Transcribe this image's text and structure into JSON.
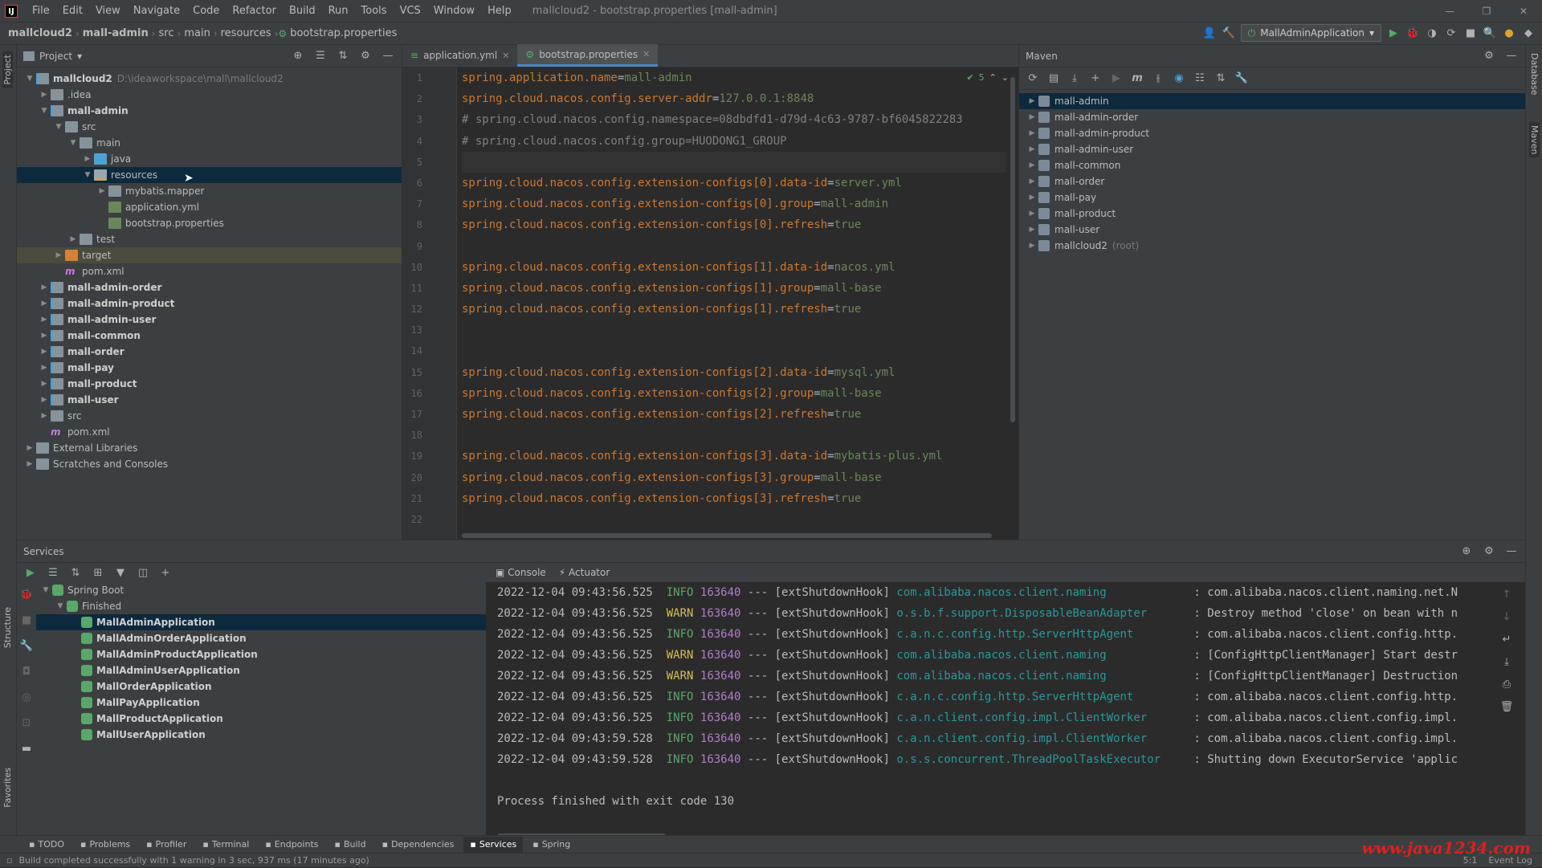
{
  "menubar": {
    "items": [
      "File",
      "Edit",
      "View",
      "Navigate",
      "Code",
      "Refactor",
      "Build",
      "Run",
      "Tools",
      "VCS",
      "Window",
      "Help"
    ],
    "title": "mallcloud2 - bootstrap.properties [mall-admin]"
  },
  "breadcrumb": [
    "mallcloud2",
    "mall-admin",
    "src",
    "main",
    "resources",
    "bootstrap.properties"
  ],
  "run_config": "MallAdminApplication",
  "project": {
    "title": "Project",
    "tree": [
      {
        "depth": 0,
        "arrow": "▼",
        "icon": "foldmod",
        "label": "mallcloud2",
        "path": "D:\\ideaworkspace\\mall\\mallcloud2",
        "bold": true
      },
      {
        "depth": 1,
        "arrow": "▶",
        "icon": "fold",
        "label": ".idea"
      },
      {
        "depth": 1,
        "arrow": "▼",
        "icon": "foldmod",
        "label": "mall-admin",
        "bold": true
      },
      {
        "depth": 2,
        "arrow": "▼",
        "icon": "fold",
        "label": "src"
      },
      {
        "depth": 3,
        "arrow": "▼",
        "icon": "fold",
        "label": "main"
      },
      {
        "depth": 4,
        "arrow": "▶",
        "icon": "foldsrc",
        "label": "java"
      },
      {
        "depth": 4,
        "arrow": "▼",
        "icon": "foldres",
        "label": "resources",
        "selected": true
      },
      {
        "depth": 5,
        "arrow": "▶",
        "icon": "fold",
        "label": "mybatis.mapper"
      },
      {
        "depth": 5,
        "arrow": "",
        "icon": "fileyml",
        "label": "application.yml"
      },
      {
        "depth": 5,
        "arrow": "",
        "icon": "fileyml",
        "label": "bootstrap.properties"
      },
      {
        "depth": 3,
        "arrow": "▶",
        "icon": "fold",
        "label": "test"
      },
      {
        "depth": 2,
        "arrow": "▶",
        "icon": "foldorange",
        "label": "target",
        "excluded": true
      },
      {
        "depth": 2,
        "arrow": "",
        "icon": "m",
        "label": "pom.xml"
      },
      {
        "depth": 1,
        "arrow": "▶",
        "icon": "foldmod",
        "label": "mall-admin-order",
        "bold": true
      },
      {
        "depth": 1,
        "arrow": "▶",
        "icon": "foldmod",
        "label": "mall-admin-product",
        "bold": true
      },
      {
        "depth": 1,
        "arrow": "▶",
        "icon": "foldmod",
        "label": "mall-admin-user",
        "bold": true
      },
      {
        "depth": 1,
        "arrow": "▶",
        "icon": "foldmod",
        "label": "mall-common",
        "bold": true
      },
      {
        "depth": 1,
        "arrow": "▶",
        "icon": "foldmod",
        "label": "mall-order",
        "bold": true
      },
      {
        "depth": 1,
        "arrow": "▶",
        "icon": "foldmod",
        "label": "mall-pay",
        "bold": true
      },
      {
        "depth": 1,
        "arrow": "▶",
        "icon": "foldmod",
        "label": "mall-product",
        "bold": true
      },
      {
        "depth": 1,
        "arrow": "▶",
        "icon": "foldmod",
        "label": "mall-user",
        "bold": true
      },
      {
        "depth": 1,
        "arrow": "▶",
        "icon": "fold",
        "label": "src"
      },
      {
        "depth": 1,
        "arrow": "",
        "icon": "m",
        "label": "pom.xml"
      },
      {
        "depth": 0,
        "arrow": "▶",
        "icon": "fold",
        "label": "External Libraries"
      },
      {
        "depth": 0,
        "arrow": "▶",
        "icon": "fold",
        "label": "Scratches and Consoles"
      }
    ]
  },
  "editor": {
    "tabs": [
      {
        "label": "application.yml",
        "active": false
      },
      {
        "label": "bootstrap.properties",
        "active": true
      }
    ],
    "inspection_count": "5",
    "lines": [
      {
        "type": "kv",
        "key": "spring.application.name",
        "val": "mall-admin"
      },
      {
        "type": "kv",
        "key": "spring.cloud.nacos.config.server-addr",
        "val": "127.0.0.1:8848"
      },
      {
        "type": "cmt",
        "text": "# spring.cloud.nacos.config.namespace=08dbdfd1-d79d-4c63-9787-bf6045822283"
      },
      {
        "type": "cmt",
        "text": "# spring.cloud.nacos.config.group=HUODONG1_GROUP"
      },
      {
        "type": "blank",
        "cur": true
      },
      {
        "type": "kv",
        "key": "spring.cloud.nacos.config.extension-configs[0].data-id",
        "val": "server.yml"
      },
      {
        "type": "kv",
        "key": "spring.cloud.nacos.config.extension-configs[0].group",
        "val": "mall-admin"
      },
      {
        "type": "kv",
        "key": "spring.cloud.nacos.config.extension-configs[0].refresh",
        "val": "true"
      },
      {
        "type": "blank"
      },
      {
        "type": "kv",
        "key": "spring.cloud.nacos.config.extension-configs[1].data-id",
        "val": "nacos.yml"
      },
      {
        "type": "kv",
        "key": "spring.cloud.nacos.config.extension-configs[1].group",
        "val": "mall-base"
      },
      {
        "type": "kv",
        "key": "spring.cloud.nacos.config.extension-configs[1].refresh",
        "val": "true"
      },
      {
        "type": "blank"
      },
      {
        "type": "blank"
      },
      {
        "type": "kv",
        "key": "spring.cloud.nacos.config.extension-configs[2].data-id",
        "val": "mysql.yml"
      },
      {
        "type": "kv",
        "key": "spring.cloud.nacos.config.extension-configs[2].group",
        "val": "mall-base"
      },
      {
        "type": "kv",
        "key": "spring.cloud.nacos.config.extension-configs[2].refresh",
        "val": "true"
      },
      {
        "type": "blank"
      },
      {
        "type": "kv",
        "key": "spring.cloud.nacos.config.extension-configs[3].data-id",
        "val": "mybatis-plus.yml"
      },
      {
        "type": "kv",
        "key": "spring.cloud.nacos.config.extension-configs[3].group",
        "val": "mall-base"
      },
      {
        "type": "kv",
        "key": "spring.cloud.nacos.config.extension-configs[3].refresh",
        "val": "true"
      },
      {
        "type": "blank"
      }
    ]
  },
  "maven": {
    "title": "Maven",
    "items": [
      {
        "label": "mall-admin",
        "selected": true
      },
      {
        "label": "mall-admin-order"
      },
      {
        "label": "mall-admin-product"
      },
      {
        "label": "mall-admin-user"
      },
      {
        "label": "mall-common"
      },
      {
        "label": "mall-order"
      },
      {
        "label": "mall-pay"
      },
      {
        "label": "mall-product"
      },
      {
        "label": "mall-user"
      },
      {
        "label": "mallcloud2",
        "suffix": "(root)"
      }
    ]
  },
  "services": {
    "title": "Services",
    "tree": [
      {
        "depth": 0,
        "arrow": "▼",
        "label": "Spring Boot"
      },
      {
        "depth": 1,
        "arrow": "▼",
        "label": "Finished"
      },
      {
        "depth": 2,
        "label": "MallAdminApplication",
        "selected": true
      },
      {
        "depth": 2,
        "label": "MallAdminOrderApplication"
      },
      {
        "depth": 2,
        "label": "MallAdminProductApplication"
      },
      {
        "depth": 2,
        "label": "MallAdminUserApplication"
      },
      {
        "depth": 2,
        "label": "MallOrderApplication"
      },
      {
        "depth": 2,
        "label": "MallPayApplication"
      },
      {
        "depth": 2,
        "label": "MallProductApplication"
      },
      {
        "depth": 2,
        "label": "MallUserApplication"
      }
    ],
    "console_tabs": [
      "Console",
      "Actuator"
    ],
    "logs": [
      {
        "ts": "2022-12-04 09:43:56.525",
        "lvl": "INFO",
        "pid": "163640",
        "thread": "[extShutdownHook]",
        "logger": "com.alibaba.nacos.client.naming",
        "msg": "com.alibaba.nacos.client.naming.net.N"
      },
      {
        "ts": "2022-12-04 09:43:56.525",
        "lvl": "WARN",
        "pid": "163640",
        "thread": "[extShutdownHook]",
        "logger": "o.s.b.f.support.DisposableBeanAdapter",
        "msg": "Destroy method 'close' on bean with n"
      },
      {
        "ts": "2022-12-04 09:43:56.525",
        "lvl": "INFO",
        "pid": "163640",
        "thread": "[extShutdownHook]",
        "logger": "c.a.n.c.config.http.ServerHttpAgent",
        "msg": "com.alibaba.nacos.client.config.http."
      },
      {
        "ts": "2022-12-04 09:43:56.525",
        "lvl": "WARN",
        "pid": "163640",
        "thread": "[extShutdownHook]",
        "logger": "com.alibaba.nacos.client.naming",
        "msg": "[ConfigHttpClientManager] Start destr"
      },
      {
        "ts": "2022-12-04 09:43:56.525",
        "lvl": "WARN",
        "pid": "163640",
        "thread": "[extShutdownHook]",
        "logger": "com.alibaba.nacos.client.naming",
        "msg": "[ConfigHttpClientManager] Destruction"
      },
      {
        "ts": "2022-12-04 09:43:56.525",
        "lvl": "INFO",
        "pid": "163640",
        "thread": "[extShutdownHook]",
        "logger": "c.a.n.c.config.http.ServerHttpAgent",
        "msg": "com.alibaba.nacos.client.config.http."
      },
      {
        "ts": "2022-12-04 09:43:56.525",
        "lvl": "INFO",
        "pid": "163640",
        "thread": "[extShutdownHook]",
        "logger": "c.a.n.client.config.impl.ClientWorker",
        "msg": "com.alibaba.nacos.client.config.impl."
      },
      {
        "ts": "2022-12-04 09:43:59.528",
        "lvl": "INFO",
        "pid": "163640",
        "thread": "[extShutdownHook]",
        "logger": "c.a.n.client.config.impl.ClientWorker",
        "msg": "com.alibaba.nacos.client.config.impl."
      },
      {
        "ts": "2022-12-04 09:43:59.528",
        "lvl": "INFO",
        "pid": "163640",
        "thread": "[extShutdownHook]",
        "logger": "o.s.s.concurrent.ThreadPoolTaskExecutor",
        "msg": "Shutting down ExecutorService 'applic"
      }
    ],
    "exit_message": "Process finished with exit code 130"
  },
  "toolwindows": [
    {
      "label": "TODO"
    },
    {
      "label": "Problems"
    },
    {
      "label": "Profiler"
    },
    {
      "label": "Terminal"
    },
    {
      "label": "Endpoints"
    },
    {
      "label": "Build"
    },
    {
      "label": "Dependencies"
    },
    {
      "label": "Services",
      "active": true
    },
    {
      "label": "Spring"
    }
  ],
  "status": {
    "message": "Build completed successfully with 1 warning in 3 sec, 937 ms (17 minutes ago)",
    "position": "5:1",
    "event_log": "Event Log"
  },
  "side_labels": {
    "left": [
      "Project",
      "Structure",
      "Favorites"
    ],
    "right": [
      "Database",
      "Maven"
    ]
  },
  "watermark": "www.java1234.com"
}
